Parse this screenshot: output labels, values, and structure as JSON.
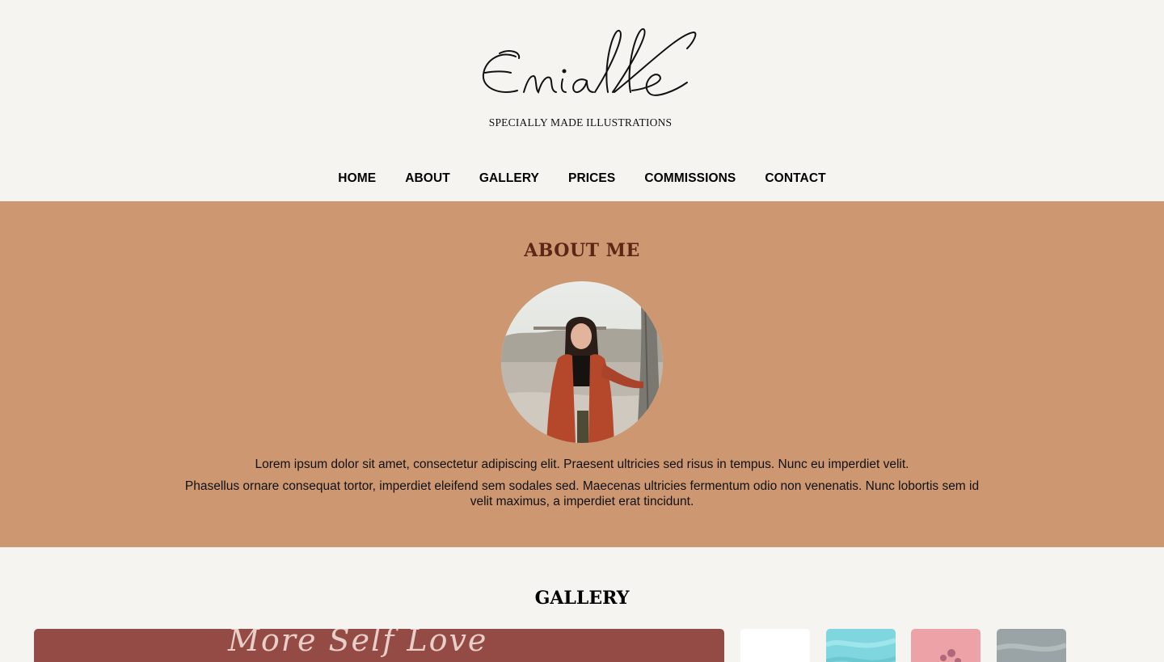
{
  "brand": {
    "name": "Enialle",
    "tagline": "SPECIALLY MADE ILLUSTRATIONS"
  },
  "nav": {
    "items": [
      {
        "label": "HOME"
      },
      {
        "label": "ABOUT"
      },
      {
        "label": "GALLERY"
      },
      {
        "label": "PRICES"
      },
      {
        "label": "COMMISSIONS"
      },
      {
        "label": "CONTACT"
      }
    ]
  },
  "about": {
    "heading": "ABOUT ME",
    "paragraph1": "Lorem ipsum dolor sit amet, consectetur adipiscing elit. Praesent ultricies sed risus in tempus. Nunc eu imperdiet velit.",
    "paragraph2": "Phasellus ornare consequat tortor, imperdiet eleifend sem sodales sed. Maecenas ultricies fermentum odio non venenatis. Nunc lobortis sem id velit maximus, a imperdiet erat tincidunt."
  },
  "gallery": {
    "heading": "GALLERY",
    "featured_text": "More Self Love",
    "thumbnails": [
      {
        "color": "#ffffff"
      },
      {
        "color": "#7fd6de"
      },
      {
        "color": "#eda2a8"
      },
      {
        "color": "#9aa4a6"
      }
    ]
  },
  "colors": {
    "page_bg": "#f5f4f0",
    "about_bg": "#cc9771",
    "about_heading": "#5b2615",
    "featured_bg": "#954b45"
  }
}
